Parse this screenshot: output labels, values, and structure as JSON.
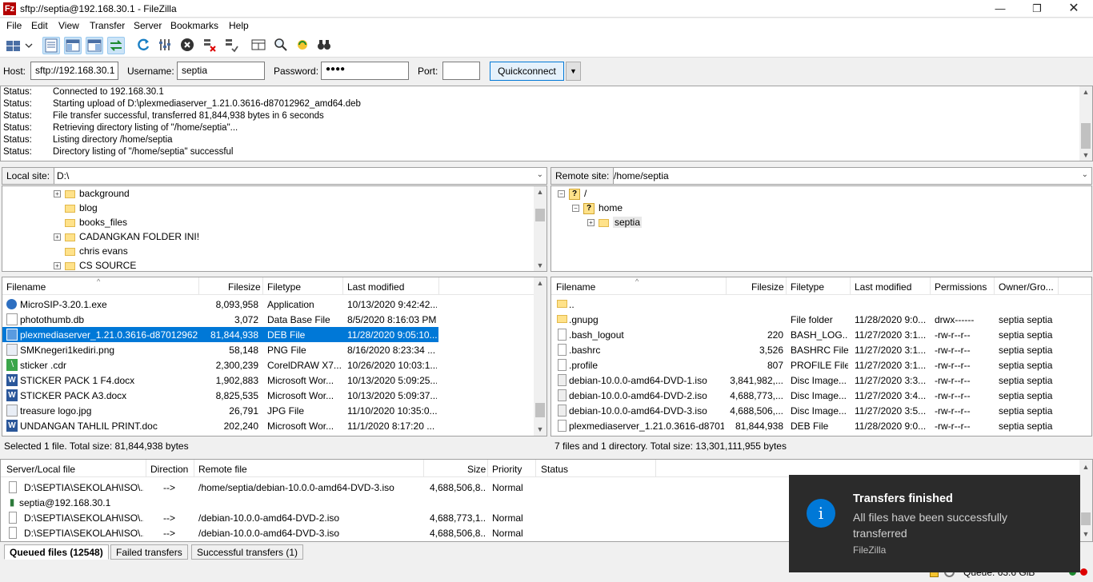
{
  "window": {
    "title": "sftp://septia@192.168.30.1 - FileZilla",
    "icon_name": "filezilla-icon"
  },
  "menu": [
    "File",
    "Edit",
    "View",
    "Transfer",
    "Server",
    "Bookmarks",
    "Help"
  ],
  "quickconnect": {
    "host_label": "Host:",
    "host_value": "sftp://192.168.30.1",
    "username_label": "Username:",
    "username_value": "septia",
    "password_label": "Password:",
    "password_value": "●●●●",
    "port_label": "Port:",
    "port_value": "",
    "button": "Quickconnect"
  },
  "log": [
    {
      "k": "Status:",
      "v": "Connected to 192.168.30.1"
    },
    {
      "k": "Status:",
      "v": "Starting upload of D:\\plexmediaserver_1.21.0.3616-d87012962_amd64.deb"
    },
    {
      "k": "Status:",
      "v": "File transfer successful, transferred 81,844,938 bytes in 6 seconds"
    },
    {
      "k": "Status:",
      "v": "Retrieving directory listing of \"/home/septia\"..."
    },
    {
      "k": "Status:",
      "v": "Listing directory /home/septia"
    },
    {
      "k": "Status:",
      "v": "Directory listing of \"/home/septia\" successful"
    }
  ],
  "local": {
    "site_label": "Local site:",
    "site_value": "D:\\",
    "tree": [
      "background",
      "blog",
      "books_files",
      "CADANGKAN FOLDER INI!",
      "chris evans",
      "CS SOURCE"
    ],
    "columns": [
      "Filename",
      "Filesize",
      "Filetype",
      "Last modified"
    ],
    "files": [
      {
        "name": "MicroSIP-3.20.1.exe",
        "size": "8,093,958",
        "type": "Application",
        "modified": "10/13/2020 9:42:42..."
      },
      {
        "name": "photothumb.db",
        "size": "3,072",
        "type": "Data Base File",
        "modified": "8/5/2020 8:16:03 PM"
      },
      {
        "name": "plexmediaserver_1.21.0.3616-d87012962_...",
        "size": "81,844,938",
        "type": "DEB File",
        "modified": "11/28/2020 9:05:10..."
      },
      {
        "name": "SMKnegeri1kediri.png",
        "size": "58,148",
        "type": "PNG File",
        "modified": "8/16/2020 8:23:34 ..."
      },
      {
        "name": "sticker .cdr",
        "size": "2,300,239",
        "type": "CorelDRAW X7...",
        "modified": "10/26/2020 10:03:1..."
      },
      {
        "name": "STICKER PACK 1 F4.docx",
        "size": "1,902,883",
        "type": "Microsoft Wor...",
        "modified": "10/13/2020 5:09:25..."
      },
      {
        "name": "STICKER PACK A3.docx",
        "size": "8,825,535",
        "type": "Microsoft Wor...",
        "modified": "10/13/2020 5:09:37..."
      },
      {
        "name": "treasure logo.jpg",
        "size": "26,791",
        "type": "JPG File",
        "modified": "11/10/2020 10:35:0..."
      },
      {
        "name": "UNDANGAN TAHLIL PRINT.doc",
        "size": "202,240",
        "type": "Microsoft Wor...",
        "modified": "11/1/2020 8:17:20 ..."
      }
    ],
    "status": "Selected 1 file. Total size: 81,844,938 bytes"
  },
  "remote": {
    "site_label": "Remote site:",
    "site_value": "/home/septia",
    "tree": [
      "/",
      "home",
      "septia"
    ],
    "columns": [
      "Filename",
      "Filesize",
      "Filetype",
      "Last modified",
      "Permissions",
      "Owner/Gro..."
    ],
    "files": [
      {
        "name": "..",
        "size": "",
        "type": "",
        "modified": "",
        "perm": "",
        "owner": ""
      },
      {
        "name": ".gnupg",
        "size": "",
        "type": "File folder",
        "modified": "11/28/2020 9:0...",
        "perm": "drwx------",
        "owner": "septia septia"
      },
      {
        "name": ".bash_logout",
        "size": "220",
        "type": "BASH_LOG...",
        "modified": "11/27/2020 3:1...",
        "perm": "-rw-r--r--",
        "owner": "septia septia"
      },
      {
        "name": ".bashrc",
        "size": "3,526",
        "type": "BASHRC File",
        "modified": "11/27/2020 3:1...",
        "perm": "-rw-r--r--",
        "owner": "septia septia"
      },
      {
        "name": ".profile",
        "size": "807",
        "type": "PROFILE File",
        "modified": "11/27/2020 3:1...",
        "perm": "-rw-r--r--",
        "owner": "septia septia"
      },
      {
        "name": "debian-10.0.0-amd64-DVD-1.iso",
        "size": "3,841,982,...",
        "type": "Disc Image...",
        "modified": "11/27/2020 3:3...",
        "perm": "-rw-r--r--",
        "owner": "septia septia"
      },
      {
        "name": "debian-10.0.0-amd64-DVD-2.iso",
        "size": "4,688,773,...",
        "type": "Disc Image...",
        "modified": "11/27/2020 3:4...",
        "perm": "-rw-r--r--",
        "owner": "septia septia"
      },
      {
        "name": "debian-10.0.0-amd64-DVD-3.iso",
        "size": "4,688,506,...",
        "type": "Disc Image...",
        "modified": "11/27/2020 3:5...",
        "perm": "-rw-r--r--",
        "owner": "septia septia"
      },
      {
        "name": "plexmediaserver_1.21.0.3616-d8701...",
        "size": "81,844,938",
        "type": "DEB File",
        "modified": "11/28/2020 9:0...",
        "perm": "-rw-r--r--",
        "owner": "septia septia"
      }
    ],
    "status": "7 files and 1 directory. Total size: 13,301,111,955 bytes"
  },
  "queue": {
    "columns": [
      "Server/Local file",
      "Direction",
      "Remote file",
      "Size",
      "Priority",
      "Status"
    ],
    "rows": [
      {
        "local": "D:\\SEPTIA\\SEKOLAH\\ISO\\...",
        "dir": "-->",
        "remote": "/home/septia/debian-10.0.0-amd64-DVD-3.iso",
        "size": "4,688,506,8...",
        "priority": "Normal",
        "status": ""
      },
      {
        "local": "septia@192.168.30.1",
        "dir": "",
        "remote": "",
        "size": "",
        "priority": "",
        "status": ""
      },
      {
        "local": "D:\\SEPTIA\\SEKOLAH\\ISO\\...",
        "dir": "-->",
        "remote": "/debian-10.0.0-amd64-DVD-2.iso",
        "size": "4,688,773,1...",
        "priority": "Normal",
        "status": ""
      },
      {
        "local": "D:\\SEPTIA\\SEKOLAH\\ISO\\...",
        "dir": "-->",
        "remote": "/debian-10.0.0-amd64-DVD-3.iso",
        "size": "4,688,506,8...",
        "priority": "Normal",
        "status": ""
      }
    ]
  },
  "tabs": [
    "Queued files (12548)",
    "Failed transfers",
    "Successful transfers (1)"
  ],
  "bottom": {
    "queue": "Queue: 63.6 GiB"
  },
  "toast": {
    "title": "Transfers finished",
    "message": "All files have been successfully transferred",
    "app": "FileZilla",
    "icon": "i"
  },
  "colors": {
    "selection": "#0078d7",
    "toast_bg": "#2b2b2b",
    "accent": "#0078d7"
  }
}
